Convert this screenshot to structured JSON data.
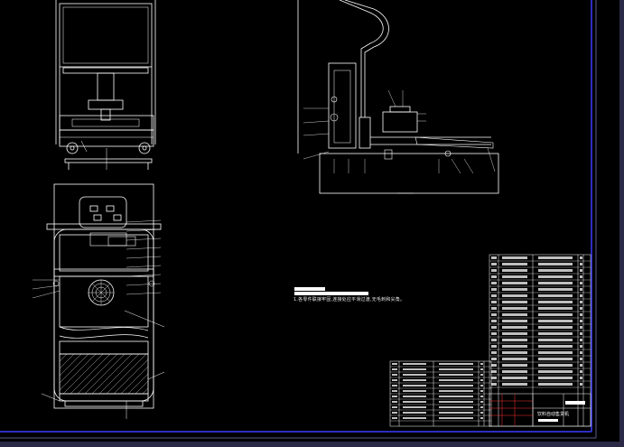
{
  "drawing": {
    "background_color": "#000000",
    "line_color": "#ffffff",
    "frame_color": "#3c3cff",
    "accent_red": "#ff3030"
  },
  "notes": {
    "requirement_text": "1.各零件联接牢固,连接处应平滑过渡,无毛刺和尖角。"
  },
  "title_block": {
    "caption": "饮料自动售货机"
  },
  "icons": {
    "fan": "fan-grille-icon"
  }
}
